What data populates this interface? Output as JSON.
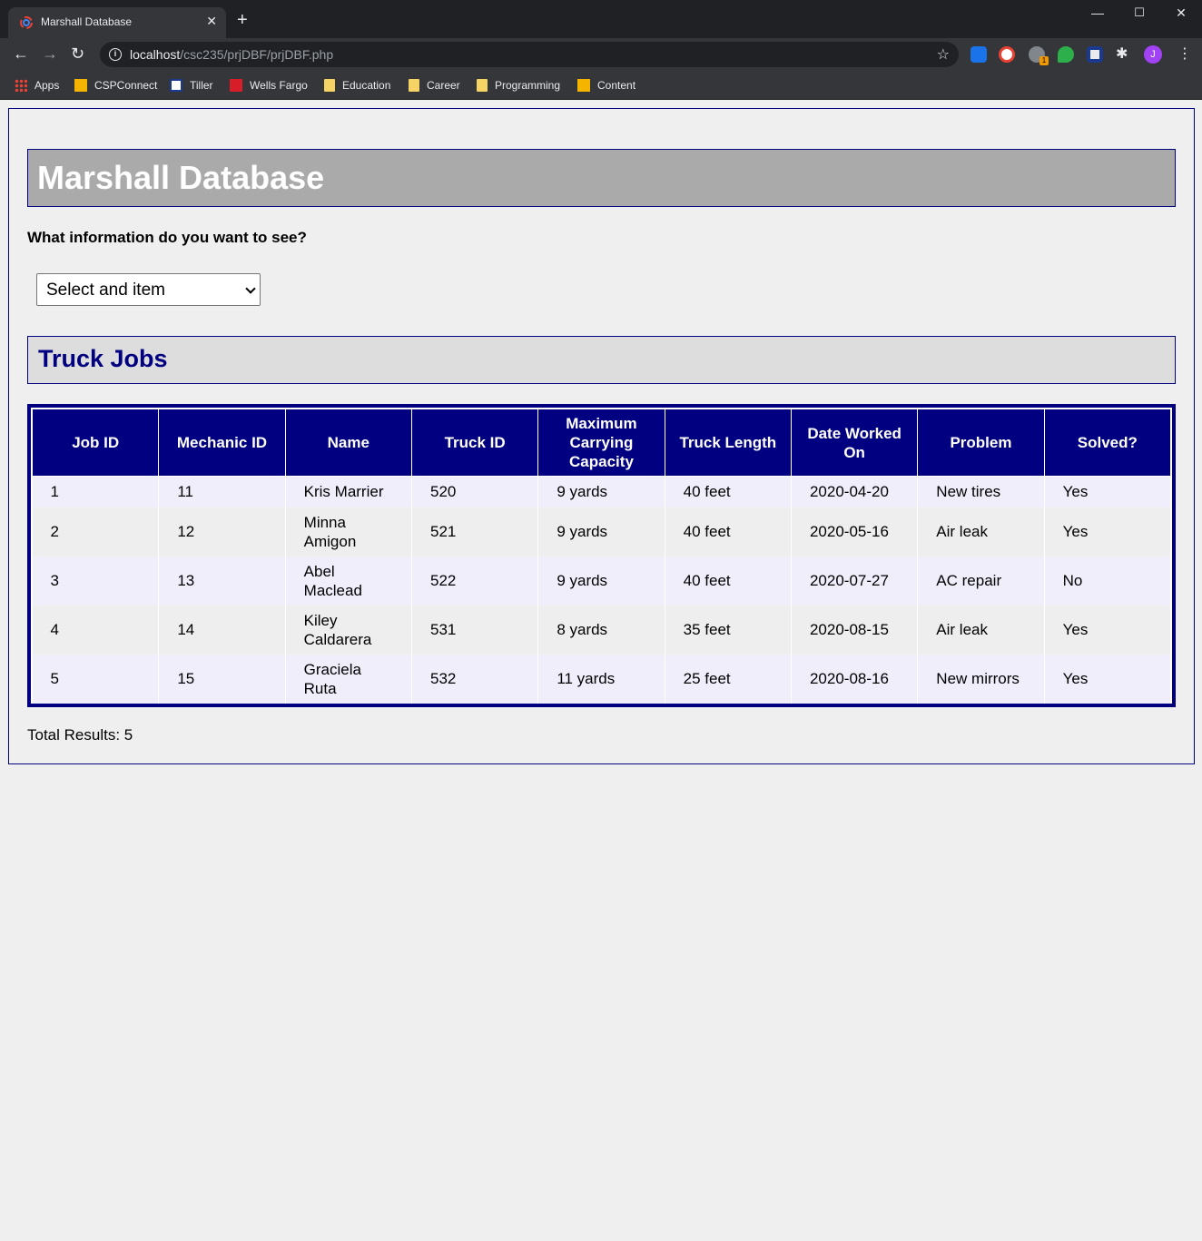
{
  "browser": {
    "tab_title": "Marshall Database",
    "url_host": "localhost",
    "url_path": "/csc235/prjDBF/prjDBF.php",
    "bookmarks": [
      {
        "label": "Apps",
        "icon": "apps-grid-icon"
      },
      {
        "label": "CSPConnect",
        "icon": "pencil-icon"
      },
      {
        "label": "Tiller",
        "icon": "tiller-icon"
      },
      {
        "label": "Wells Fargo",
        "icon": "wells-fargo-icon"
      },
      {
        "label": "Education",
        "icon": "folder-icon"
      },
      {
        "label": "Career",
        "icon": "folder-icon"
      },
      {
        "label": "Programming",
        "icon": "folder-icon"
      },
      {
        "label": "Content",
        "icon": "pencil-icon"
      }
    ],
    "profile_initial": "J",
    "extension_badge": "1"
  },
  "page": {
    "title": "Marshall Database",
    "question": "What information do you want to see?",
    "select_value": "Select and item",
    "section_title": "Truck Jobs",
    "total_label": "Total Results: 5"
  },
  "table": {
    "headers": [
      "Job ID",
      "Mechanic ID",
      "Name",
      "Truck ID",
      "Maximum Carrying Capacity",
      "Truck Length",
      "Date Worked On",
      "Problem",
      "Solved?"
    ],
    "rows": [
      [
        "1",
        "11",
        "Kris Marrier",
        "520",
        "9 yards",
        "40 feet",
        "2020-04-20",
        "New tires",
        "Yes"
      ],
      [
        "2",
        "12",
        "Minna Amigon",
        "521",
        "9 yards",
        "40 feet",
        "2020-05-16",
        "Air leak",
        "Yes"
      ],
      [
        "3",
        "13",
        "Abel Maclead",
        "522",
        "9 yards",
        "40 feet",
        "2020-07-27",
        "AC repair",
        "No"
      ],
      [
        "4",
        "14",
        "Kiley Caldarera",
        "531",
        "8 yards",
        "35 feet",
        "2020-08-15",
        "Air leak",
        "Yes"
      ],
      [
        "5",
        "15",
        "Graciela Ruta",
        "532",
        "11 yards",
        "25 feet",
        "2020-08-16",
        "New mirrors",
        "Yes"
      ]
    ]
  },
  "colors": {
    "navy": "#000080",
    "header_gray": "#aaaaaa",
    "section_gray": "#dddddd",
    "row_odd": "#f1eefc",
    "row_even": "#eeeeee"
  }
}
